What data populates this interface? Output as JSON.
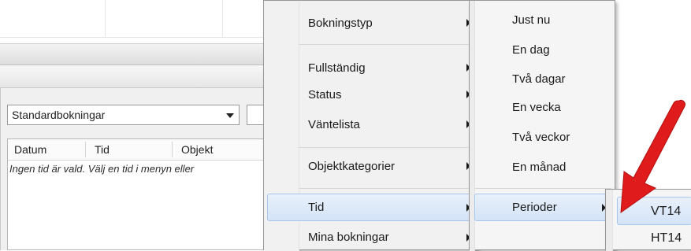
{
  "filter": {
    "selected_value": "Standardbokningar"
  },
  "table": {
    "columns": [
      "Datum",
      "Tid",
      "Objekt"
    ],
    "empty_message": "Ingen tid är vald. Välj en tid i menyn eller"
  },
  "context_menu": {
    "items": [
      {
        "label": "Bokningstyp",
        "has_submenu": true
      },
      {
        "label": "Fullständig",
        "has_submenu": true
      },
      {
        "label": "Status",
        "has_submenu": true
      },
      {
        "label": "Väntelista",
        "has_submenu": true
      },
      {
        "label": "Objektkategorier",
        "has_submenu": true
      },
      {
        "label": "Tid",
        "has_submenu": true,
        "highlighted": true
      },
      {
        "label": "Mina bokningar",
        "has_submenu": true
      }
    ]
  },
  "time_submenu": {
    "items": [
      {
        "label": "Just nu"
      },
      {
        "label": "En dag"
      },
      {
        "label": "Två dagar"
      },
      {
        "label": "En vecka"
      },
      {
        "label": "Två veckor"
      },
      {
        "label": "En månad"
      },
      {
        "label": "Perioder",
        "has_submenu": true,
        "highlighted": true
      }
    ]
  },
  "periods_submenu": {
    "items": [
      {
        "label": "VT14",
        "highlighted": true
      },
      {
        "label": "HT14"
      }
    ]
  },
  "colors": {
    "highlight": "#d4e4f7",
    "annotation_arrow": "#e01b1b"
  }
}
